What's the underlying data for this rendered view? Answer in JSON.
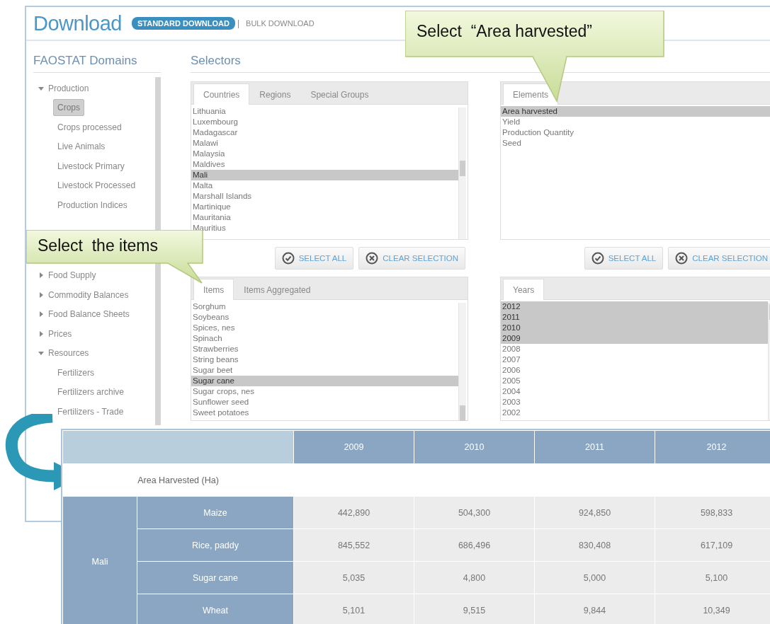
{
  "header": {
    "title": "Download",
    "separator": "|",
    "tabs": [
      {
        "label": "STANDARD DOWNLOAD",
        "selected": true
      },
      {
        "label": "BULK DOWNLOAD",
        "selected": false
      }
    ]
  },
  "sidebar": {
    "title": "FAOSTAT Domains",
    "items": [
      {
        "label": "Production",
        "expanded": true,
        "children": [
          {
            "label": "Crops",
            "selected": true
          },
          {
            "label": "Crops processed",
            "selected": false
          },
          {
            "label": "Live Animals",
            "selected": false
          },
          {
            "label": "Livestock Primary",
            "selected": false
          },
          {
            "label": "Livestock Processed",
            "selected": false
          },
          {
            "label": "Production Indices",
            "selected": false
          }
        ]
      },
      {
        "label": "Food Supply",
        "expanded": false
      },
      {
        "label": "Commodity Balances",
        "expanded": false
      },
      {
        "label": "Food Balance Sheets",
        "expanded": false
      },
      {
        "label": "Prices",
        "expanded": false
      },
      {
        "label": "Resources",
        "expanded": true,
        "children": [
          {
            "label": "Fertilizers",
            "selected": false
          },
          {
            "label": "Fertilizers archive",
            "selected": false
          },
          {
            "label": "Fertilizers - Trade",
            "selected": false
          }
        ]
      }
    ]
  },
  "selectors": {
    "title": "Selectors",
    "panels": [
      {
        "tabs": [
          {
            "label": "Countries",
            "selected": true
          },
          {
            "label": "Regions",
            "selected": false
          },
          {
            "label": "Special Groups",
            "selected": false
          }
        ],
        "options": [
          {
            "label": "Lithuania",
            "selected": false
          },
          {
            "label": "Luxembourg",
            "selected": false
          },
          {
            "label": "Madagascar",
            "selected": false
          },
          {
            "label": "Malawi",
            "selected": false
          },
          {
            "label": "Malaysia",
            "selected": false
          },
          {
            "label": "Maldives",
            "selected": false
          },
          {
            "label": "Mali",
            "selected": true
          },
          {
            "label": "Malta",
            "selected": false
          },
          {
            "label": "Marshall Islands",
            "selected": false
          },
          {
            "label": "Martinique",
            "selected": false
          },
          {
            "label": "Mauritania",
            "selected": false
          },
          {
            "label": "Mauritius",
            "selected": false
          }
        ],
        "buttons": [
          {
            "kind": "select_all",
            "label": "SELECT ALL"
          },
          {
            "kind": "clear",
            "label": "CLEAR SELECTION"
          }
        ]
      },
      {
        "tabs": [
          {
            "label": "Elements",
            "selected": true
          }
        ],
        "options": [
          {
            "label": "Area harvested",
            "selected": true
          },
          {
            "label": "Yield",
            "selected": false
          },
          {
            "label": "Production Quantity",
            "selected": false
          },
          {
            "label": "Seed",
            "selected": false
          }
        ],
        "buttons": [
          {
            "kind": "select_all",
            "label": "SELECT ALL"
          },
          {
            "kind": "clear",
            "label": "CLEAR SELECTION"
          }
        ]
      },
      {
        "tabs": [
          {
            "label": "Items",
            "selected": true
          },
          {
            "label": "Items Aggregated",
            "selected": false
          }
        ],
        "options": [
          {
            "label": "Sorghum",
            "selected": false
          },
          {
            "label": "Soybeans",
            "selected": false
          },
          {
            "label": "Spices, nes",
            "selected": false
          },
          {
            "label": "Spinach",
            "selected": false
          },
          {
            "label": "Strawberries",
            "selected": false
          },
          {
            "label": "String beans",
            "selected": false
          },
          {
            "label": "Sugar beet",
            "selected": false
          },
          {
            "label": "Sugar cane",
            "selected": true
          },
          {
            "label": "Sugar crops, nes",
            "selected": false
          },
          {
            "label": "Sunflower seed",
            "selected": false
          },
          {
            "label": "Sweet potatoes",
            "selected": false
          }
        ]
      },
      {
        "tabs": [
          {
            "label": "Years",
            "selected": true
          }
        ],
        "options": [
          {
            "label": "2012",
            "selected": true
          },
          {
            "label": "2011",
            "selected": true
          },
          {
            "label": "2010",
            "selected": true
          },
          {
            "label": "2009",
            "selected": true
          },
          {
            "label": "2008",
            "selected": false
          },
          {
            "label": "2007",
            "selected": false
          },
          {
            "label": "2006",
            "selected": false
          },
          {
            "label": "2005",
            "selected": false
          },
          {
            "label": "2004",
            "selected": false
          },
          {
            "label": "2003",
            "selected": false
          },
          {
            "label": "2002",
            "selected": false
          }
        ]
      }
    ]
  },
  "callouts": [
    {
      "text": "Select  “Area harvested”"
    },
    {
      "text": "Select  the items"
    }
  ],
  "table": {
    "columns": [
      "2009",
      "2010",
      "2011",
      "2012"
    ],
    "measure": "Area Harvested (Ha)",
    "group": "Mali",
    "rows": [
      {
        "item": "Maize",
        "values": [
          "442,890",
          "504,300",
          "924,850",
          "598,833"
        ]
      },
      {
        "item": "Rice, paddy",
        "values": [
          "845,552",
          "686,496",
          "830,408",
          "617,109"
        ]
      },
      {
        "item": "Sugar cane",
        "values": [
          "5,035",
          "4,800",
          "5,000",
          "5,100"
        ]
      },
      {
        "item": "Wheat",
        "values": [
          "5,101",
          "9,515",
          "9,844",
          "10,349"
        ]
      }
    ]
  }
}
